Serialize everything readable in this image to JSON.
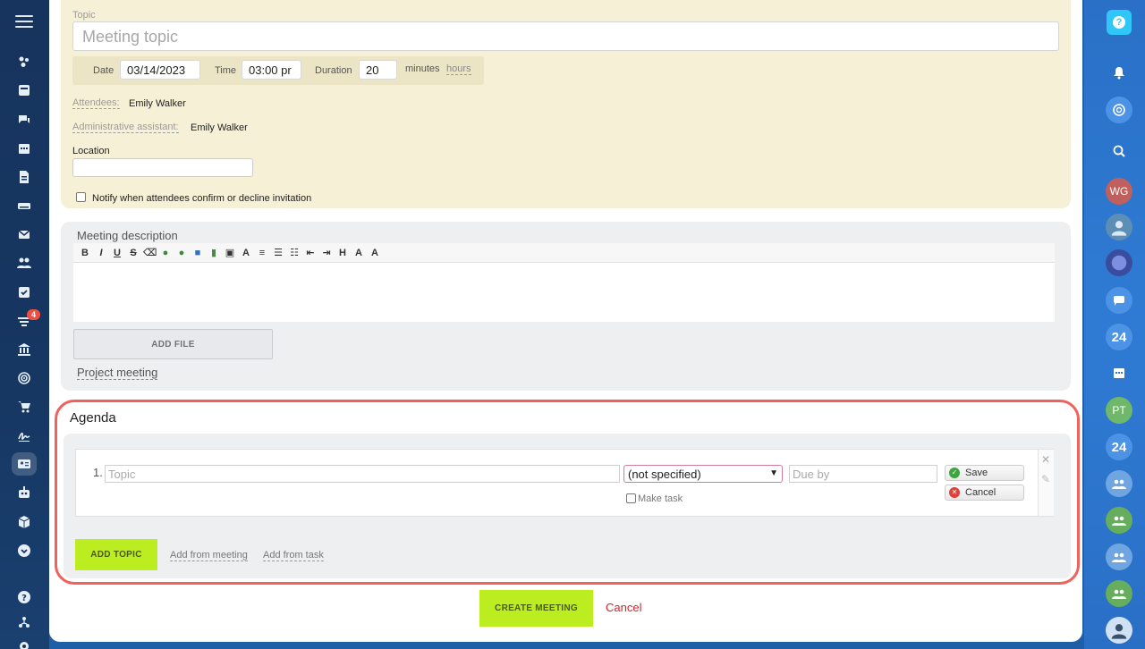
{
  "left_sidebar": {
    "badge_count": "4"
  },
  "right_sidebar": {
    "avatars": [
      {
        "initials": "WG",
        "color": "#c0605e"
      },
      {
        "initials": "PT",
        "color": "#6fb86a"
      }
    ],
    "brand_label": "24"
  },
  "topic": {
    "label": "Topic",
    "placeholder": "Meeting topic"
  },
  "datetime": {
    "date_label": "Date",
    "date_value": "03/14/2023",
    "time_label": "Time",
    "time_value": "03:00 pr",
    "duration_label": "Duration",
    "duration_value": "20",
    "unit_minutes": "minutes",
    "unit_hours": "hours"
  },
  "attendees": {
    "label": "Attendees:",
    "value": "Emily Walker"
  },
  "assistant": {
    "label": "Administrative assistant:",
    "value": "Emily Walker"
  },
  "location": {
    "label": "Location",
    "value": ""
  },
  "notify": {
    "label": "Notify when attendees confirm or decline invitation"
  },
  "description": {
    "title": "Meeting description",
    "add_file": "ADD FILE",
    "project_link": "Project meeting"
  },
  "agenda": {
    "title": "Agenda",
    "item_number": "1.",
    "topic_placeholder": "Topic",
    "responsible_value": "(not specified)",
    "due_placeholder": "Due by",
    "make_task": "Make task",
    "save": "Save",
    "cancel": "Cancel",
    "add_topic": "ADD TOPIC",
    "add_from_meeting": "Add from meeting",
    "add_from_task": "Add from task"
  },
  "footer": {
    "create": "CREATE MEETING",
    "cancel": "Cancel"
  },
  "colors": {
    "accent_green": "#bbed21",
    "highlight_red": "#f0625b",
    "sidebar_left": "#17345e",
    "sidebar_right": "#2a70c7"
  }
}
